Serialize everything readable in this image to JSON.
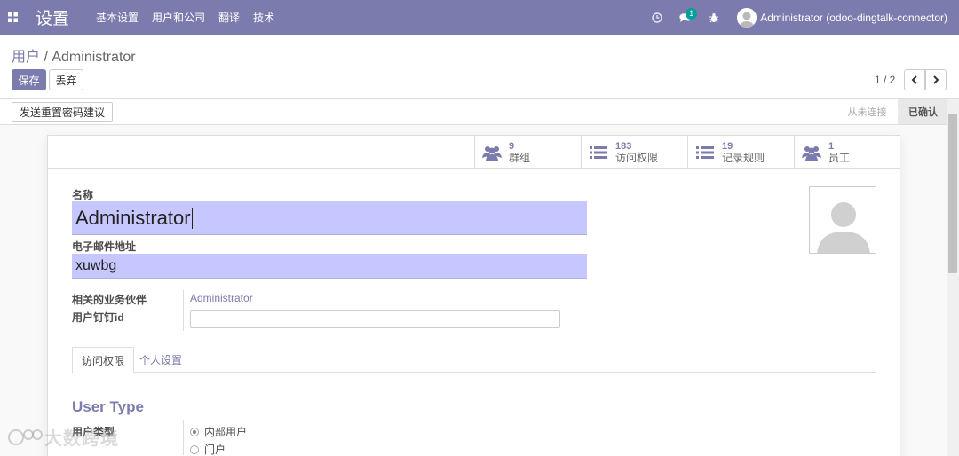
{
  "navbar": {
    "brand": "设置",
    "menu": [
      "基本设置",
      "用户和公司",
      "翻译",
      "技术"
    ],
    "message_count": "1",
    "user_name": "Administrator (odoo-dingtalk-connector)"
  },
  "breadcrumb": {
    "parent": "用户",
    "separator": " / ",
    "current": "Administrator"
  },
  "buttons": {
    "save": "保存",
    "discard": "丢弃"
  },
  "pager": {
    "value": "1 / 2"
  },
  "statusbar": {
    "reset_button": "发送重置密码建议",
    "stages": [
      "从未连接",
      "已确认"
    ],
    "active_stage": "已确认"
  },
  "smart_buttons": [
    {
      "value": "9",
      "label": "群组",
      "icon": "users-icon"
    },
    {
      "value": "183",
      "label": "访问权限",
      "icon": "list-icon"
    },
    {
      "value": "19",
      "label": "记录规则",
      "icon": "list-icon"
    },
    {
      "value": "1",
      "label": "员工",
      "icon": "users-icon"
    }
  ],
  "form": {
    "name_label": "名称",
    "name_value": "Administrator",
    "email_label": "电子邮件地址",
    "email_value": "xuwbg",
    "partner_label": "相关的业务伙伴",
    "partner_value": "Administrator",
    "dingtalk_label": "用户钉钉id",
    "dingtalk_value": ""
  },
  "tabs": [
    "访问权限",
    "个人设置"
  ],
  "user_type": {
    "section_title": "User Type",
    "label": "用户类型",
    "options": [
      "内部用户",
      "门户"
    ],
    "selected": "内部用户"
  },
  "watermark": "大数跨境",
  "colors": {
    "primary": "#7c7bad",
    "field_bg": "#c7c7ff"
  }
}
